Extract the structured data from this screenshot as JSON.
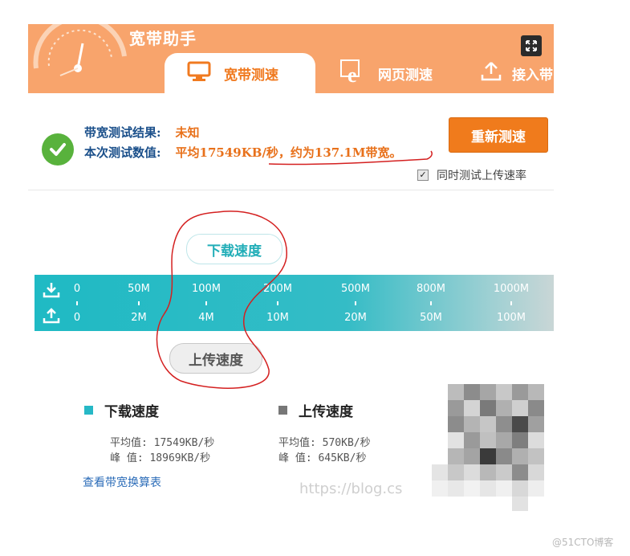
{
  "header": {
    "app_title": "宽带助手",
    "close_icon": "expand-arrows-icon",
    "tabs": [
      {
        "label": "宽带测速",
        "icon": "monitor-icon",
        "active": true
      },
      {
        "label": "网页测速",
        "icon": "ie-browser-icon",
        "active": false
      },
      {
        "label": "接入带",
        "icon": "upload-tray-icon",
        "active": false
      }
    ]
  },
  "result": {
    "bandwidth_label": "带宽测试结果:",
    "bandwidth_value": "未知",
    "measure_label": "本次测试数值:",
    "measure_value": "平均17549KB/秒，约为137.1M带宽。",
    "retest_button": "重新测速",
    "upload_checkbox_label": "同时测试上传速率",
    "upload_checkbox_checked": true
  },
  "speed_scale": {
    "download_bubble": "下载速度",
    "upload_bubble": "上传速度",
    "download_ticks": [
      "0",
      "50M",
      "100M",
      "200M",
      "500M",
      "800M",
      "1000M"
    ],
    "upload_ticks": [
      "0",
      "2M",
      "4M",
      "10M",
      "20M",
      "50M",
      "100M"
    ],
    "download_icon": "download-tray-icon",
    "upload_icon": "upload-tray-icon"
  },
  "stats": {
    "download": {
      "title": "下载速度",
      "avg": "平均值: 17549KB/秒",
      "peak": "峰  值: 18969KB/秒",
      "color": "#26b8c6"
    },
    "upload": {
      "title": "上传速度",
      "avg": "平均值: 570KB/秒",
      "peak": "峰  值: 645KB/秒",
      "color": "#777777"
    },
    "link": "查看带宽换算表"
  },
  "watermark": "https://blog.cs",
  "footer_mark": "@51CTO博客",
  "colors": {
    "header_bg": "#f8a46c",
    "accent_orange": "#f07b1c",
    "teal": "#1fbac4",
    "label_blue": "#1a4f8a",
    "annotation_red": "#d42020"
  }
}
